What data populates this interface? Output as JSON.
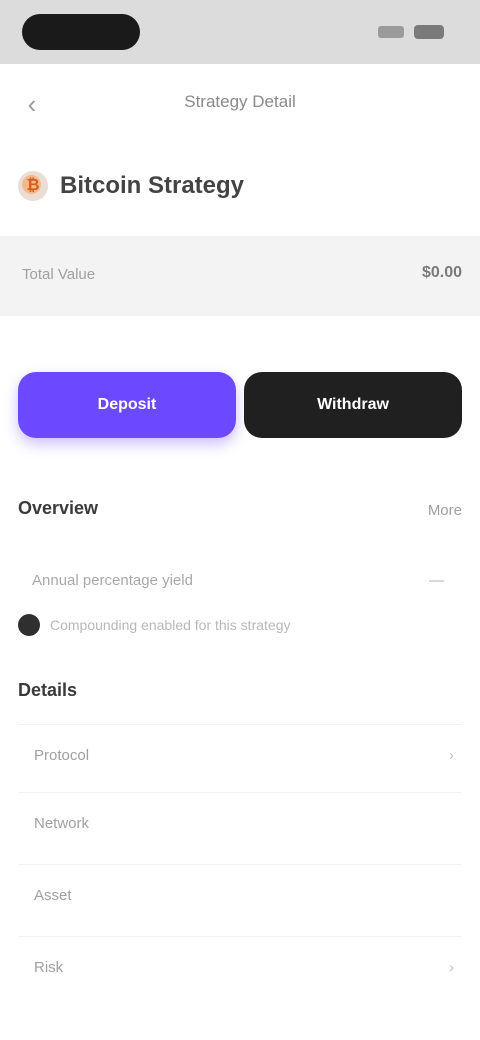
{
  "statusbar": {
    "icons": [
      "signal-icon",
      "battery-icon"
    ]
  },
  "nav": {
    "back_icon": "chevron-left-icon",
    "title": "Strategy Detail"
  },
  "asset": {
    "logo_icon": "coin-icon",
    "name": "Bitcoin Strategy"
  },
  "info": {
    "label": "Total Value",
    "value": "$0.00"
  },
  "segment": {
    "left_label": "Deposit",
    "right_label": "Withdraw"
  },
  "overview": {
    "title": "Overview",
    "link": "More"
  },
  "overview_line": {
    "text": "Annual percentage yield",
    "right": "—"
  },
  "check": {
    "text": "Compounding enabled for this strategy"
  },
  "details": {
    "title": "Details",
    "items": [
      {
        "label": "Protocol",
        "right": "›"
      },
      {
        "label": "Network",
        "right": ""
      },
      {
        "label": "Asset",
        "right": ""
      },
      {
        "label": "Risk",
        "right": "›"
      }
    ]
  },
  "colors": {
    "accent": "#6c48ff",
    "dark_button": "#202020"
  }
}
